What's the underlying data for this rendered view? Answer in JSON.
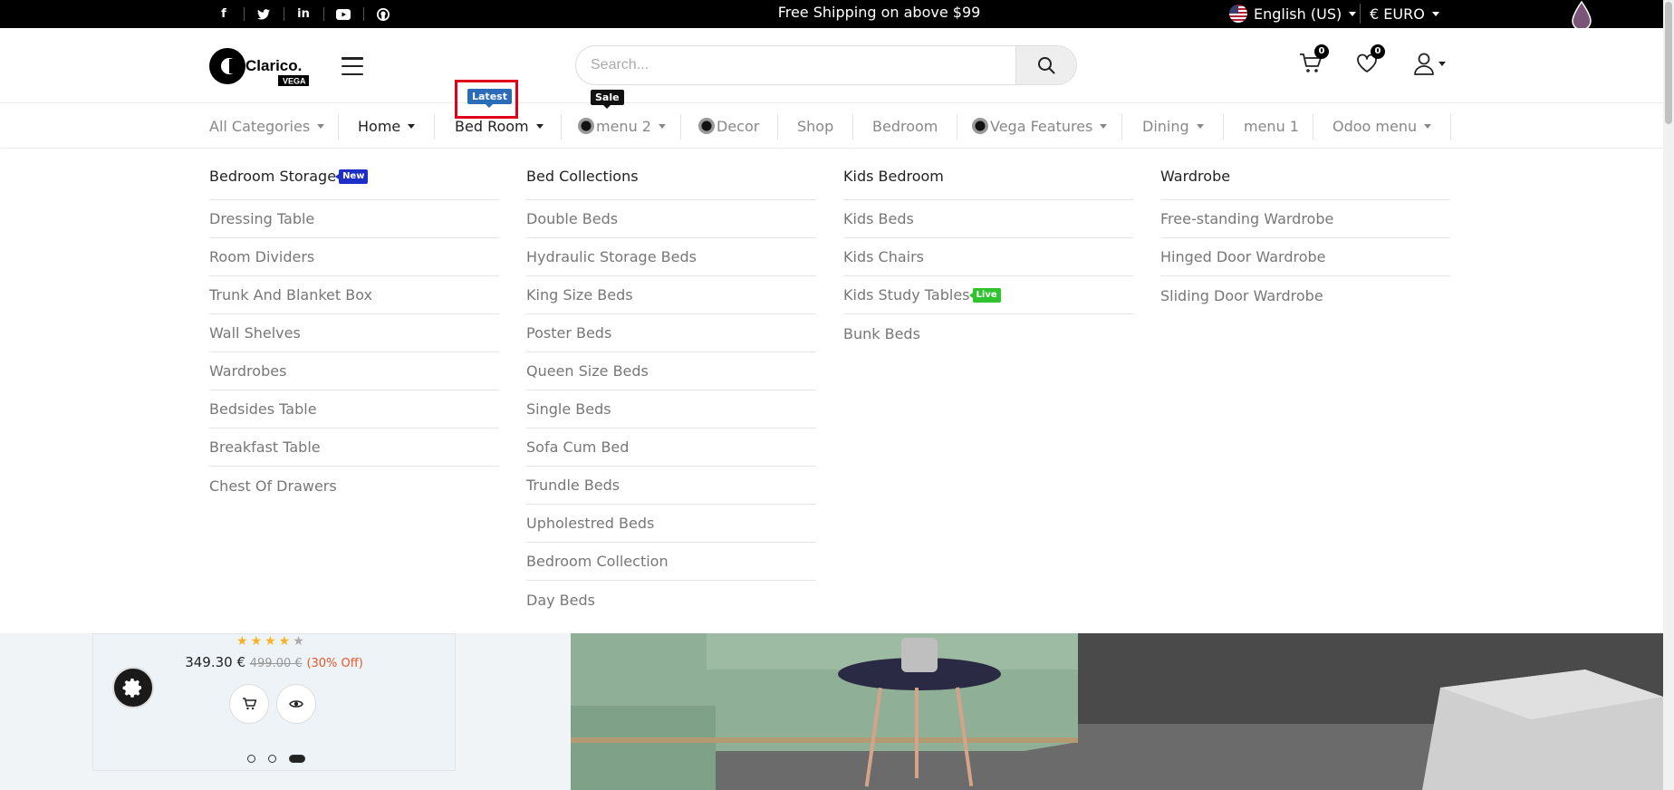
{
  "topbar": {
    "social": [
      "facebook-icon",
      "twitter-icon",
      "linkedin-icon",
      "youtube-icon",
      "github-icon"
    ],
    "shipping_text": "Free Shipping on above $99",
    "language": "English (US)",
    "currency": "€ EURO"
  },
  "header": {
    "logo_text": "Clarico.",
    "logo_sub": "VEGA",
    "search_placeholder": "Search...",
    "cart_count": "0",
    "wishlist_count": "0"
  },
  "nav": {
    "items": [
      "All Categories",
      "Home",
      "Bed Room",
      "menu 2",
      "Decor",
      "Shop",
      "Bedroom",
      "Vega Features",
      "Dining",
      "menu 1",
      "Odoo menu"
    ],
    "tag_latest": "Latest",
    "tag_sale": "Sale"
  },
  "mega": {
    "columns": [
      {
        "title": "Bedroom Storage",
        "badge": "New",
        "links": [
          "Dressing Table",
          "Room Dividers",
          "Trunk And Blanket Box",
          "Wall Shelves",
          "Wardrobes",
          "Bedsides Table",
          "Breakfast Table",
          "Chest Of Drawers"
        ]
      },
      {
        "title": "Bed Collections",
        "links": [
          "Double Beds",
          "Hydraulic Storage Beds",
          "King Size Beds",
          "Poster Beds",
          "Queen Size Beds",
          "Single Beds",
          "Sofa Cum Bed",
          "Trundle Beds",
          "Upholestred Beds",
          "Bedroom Collection",
          "Day Beds"
        ]
      },
      {
        "title": "Kids Bedroom",
        "links": [
          "Kids Beds",
          "Kids Chairs",
          "Kids Study Tables",
          "Bunk Beds"
        ],
        "badge_item": "Live"
      },
      {
        "title": "Wardrobe",
        "links": [
          "Free-standing Wardrobe",
          "Hinged Door Wardrobe",
          "Sliding Door Wardrobe"
        ]
      }
    ]
  },
  "product": {
    "rating": 4,
    "rating_max": 5,
    "price": "349.30 €",
    "old_price": "499.00 €",
    "discount": "(30% Off)"
  },
  "carousel": {
    "active_index": 3,
    "total": 3
  },
  "colors": {
    "accent_blue": "#2b6cb8",
    "new_badge": "#1d2fc6",
    "live_badge": "#2fc32f",
    "highlight": "#e0001b"
  }
}
